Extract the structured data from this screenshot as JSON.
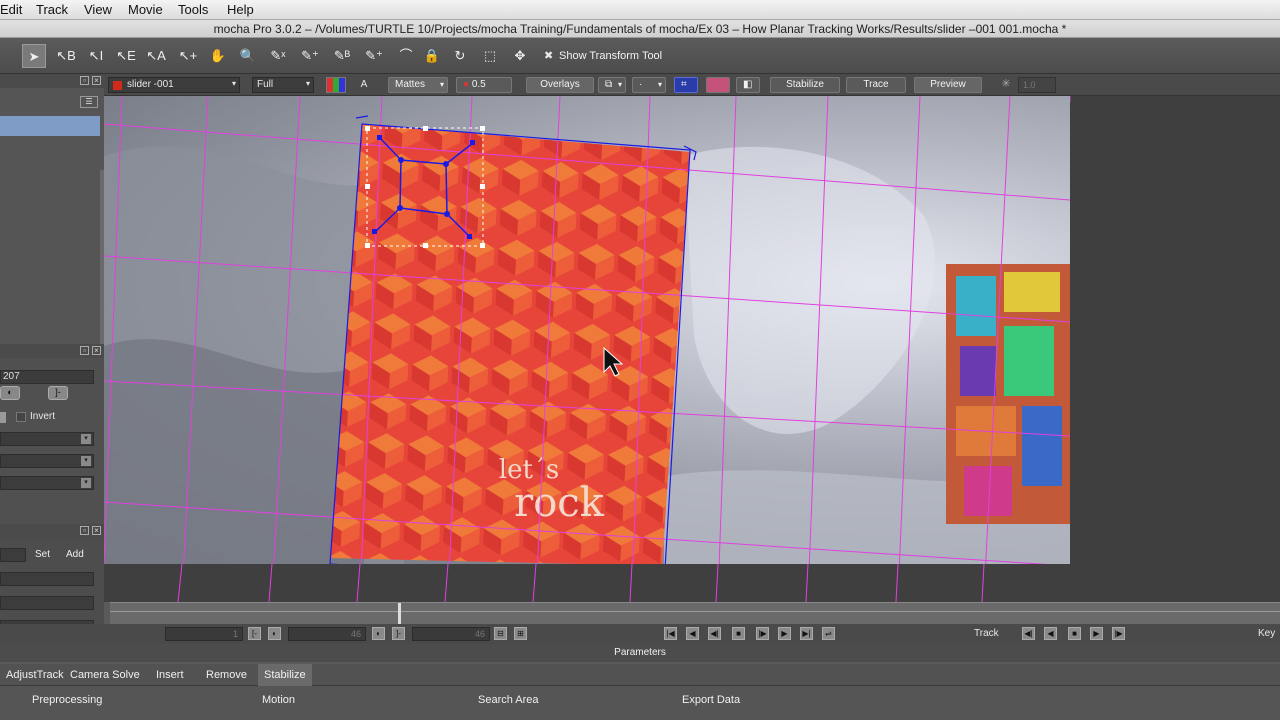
{
  "menu": {
    "edit": "Edit",
    "track": "Track",
    "view": "View",
    "movie": "Movie",
    "tools": "Tools",
    "help": "Help"
  },
  "window_title": "mocha Pro 3.0.2 – /Volumes/TURTLE 10/Projects/mocha Training/Fundamentals of mocha/Ex 03 – How Planar Tracking Works/Results/slider –001 001.mocha *",
  "tools": {
    "show_transform_tool": "Show Transform Tool"
  },
  "viewer_toolbar": {
    "layer": "slider -001",
    "resolution": "Full",
    "mattes": "Mattes",
    "opacity": "0.5",
    "overlays": "Overlays",
    "stabilize": "Stabilize",
    "trace": "Trace",
    "preview": "Preview",
    "frame_value": "1.0"
  },
  "left_panel": {
    "value_field": "207",
    "invert": "Invert",
    "set": "Set",
    "add": "Add"
  },
  "playback": {
    "in_frame": "1",
    "current_frame": "46",
    "out_frame": "46",
    "track_label": "Track",
    "key_label": "Key"
  },
  "parameters": {
    "header": "Parameters",
    "tabs": [
      "AdjustTrack",
      "Camera Solve",
      "Insert",
      "Remove",
      "Stabilize"
    ],
    "sections": [
      "Preprocessing",
      "Motion",
      "Search Area",
      "Export Data"
    ]
  },
  "poster_text": {
    "line1": "let´s",
    "line2": "rock"
  },
  "colors": {
    "spline": "#1a1ae6",
    "grid": "#e040e0",
    "poster": "#e8453a",
    "layer_swatch": "#d12a1a"
  }
}
